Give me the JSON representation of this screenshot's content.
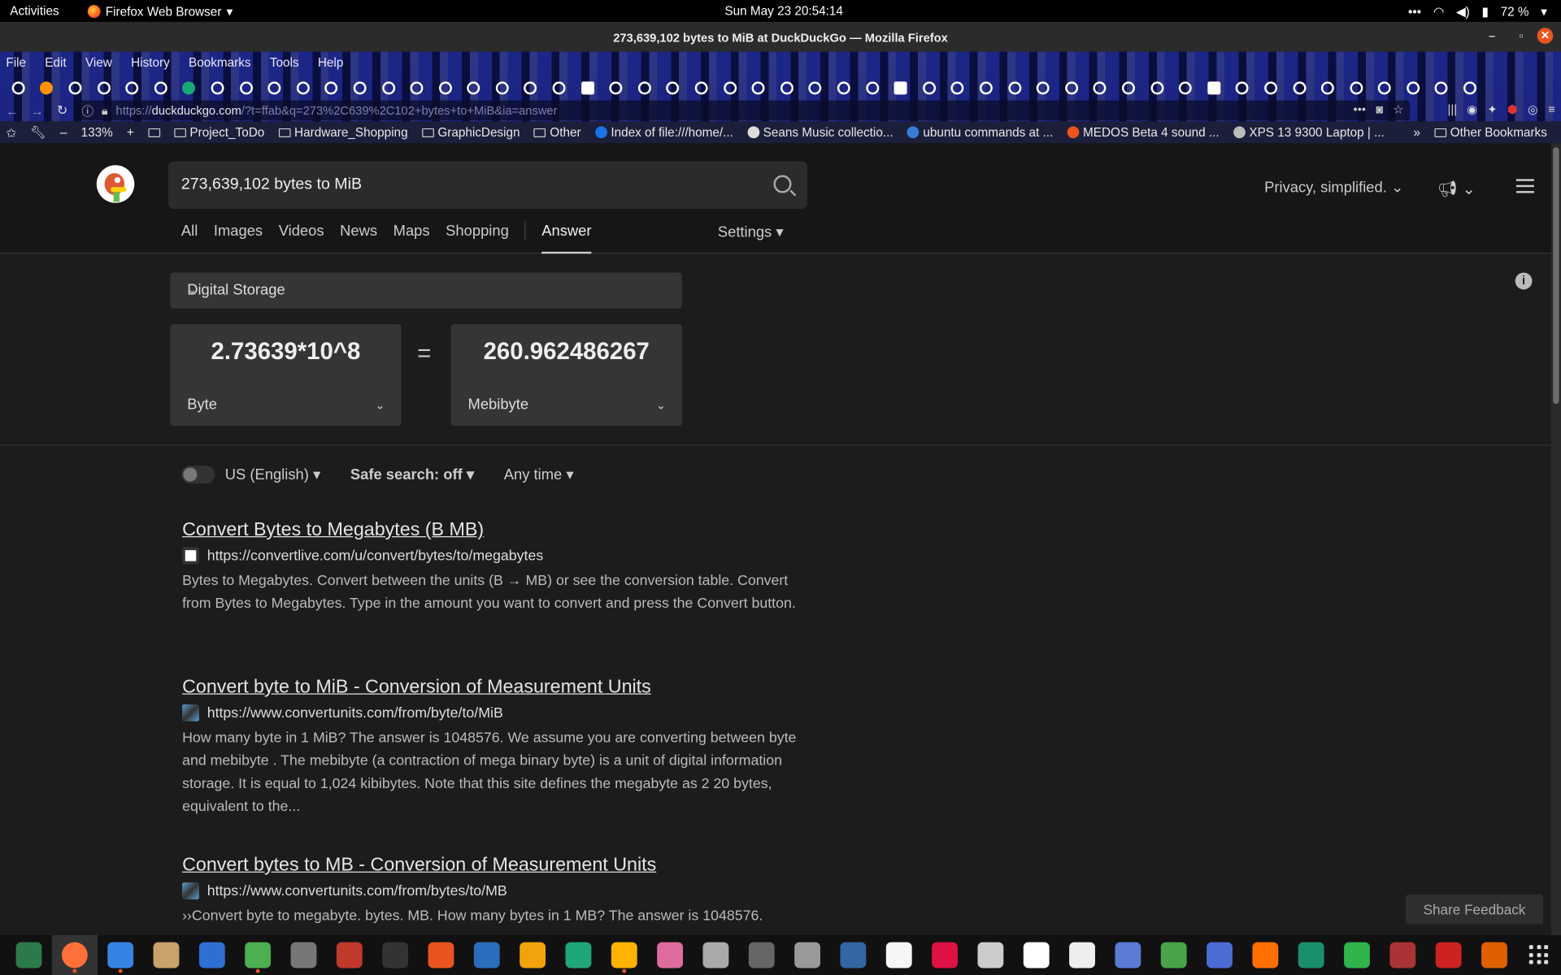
{
  "topbar": {
    "activities": "Activities",
    "app_name": "Firefox Web Browser",
    "clock": "Sun May 23  20:54:14",
    "battery": "72 %"
  },
  "window": {
    "title": "273,639,102 bytes to MiB at DuckDuckGo — Mozilla Firefox"
  },
  "menubar": [
    "File",
    "Edit",
    "View",
    "History",
    "Bookmarks",
    "Tools",
    "Help"
  ],
  "urlbar": {
    "host": "duckduckgo.com",
    "url_rest": "/?t=ffab&q=273%2C639%2C102+bytes+to+MiB&ia=answer",
    "zoom": "133%"
  },
  "bookmarks": [
    {
      "label": "Project_ToDo",
      "kind": "folder"
    },
    {
      "label": "Hardware_Shopping",
      "kind": "folder"
    },
    {
      "label": "GraphicDesign",
      "kind": "folder"
    },
    {
      "label": "Other",
      "kind": "folder"
    },
    {
      "label": "Index of file:///home/...",
      "kind": "page"
    },
    {
      "label": "Seans Music collectio...",
      "kind": "page"
    },
    {
      "label": "ubuntu commands at ...",
      "kind": "page"
    },
    {
      "label": "MEDOS Beta 4 sound ...",
      "kind": "page"
    },
    {
      "label": "XPS 13 9300 Laptop | ...",
      "kind": "page"
    }
  ],
  "other_bookmarks": "Other Bookmarks",
  "search": {
    "query": "273,639,102 bytes to MiB",
    "privacy": "Privacy, simplified.",
    "tabs": [
      "All",
      "Images",
      "Videos",
      "News",
      "Maps",
      "Shopping"
    ],
    "active_tab": "Answer",
    "settings": "Settings"
  },
  "converter": {
    "category": "Digital Storage",
    "from_value": "2.73639*10^8",
    "from_unit": "Byte",
    "equals": "=",
    "to_value": "260.962486267",
    "to_unit": "Mebibyte"
  },
  "filters": {
    "region": "US (English)",
    "safe_search": "Safe search: off",
    "time": "Any time"
  },
  "results": [
    {
      "title": "Convert Bytes to Megabytes (B MB)",
      "url": "https://convertlive.com/u/convert/bytes/to/megabytes",
      "snippet": "Bytes to Megabytes. Convert between the units (B → MB) or see the conversion table. Convert from Bytes to Megabytes. Type in the amount you want to convert and press the Convert button."
    },
    {
      "title": "Convert byte to MiB - Conversion of Measurement Units",
      "url": "https://www.convertunits.com/from/byte/to/MiB",
      "snippet": "How many byte in 1 MiB? The answer is 1048576. We assume you are converting between byte and mebibyte . The mebibyte (a contraction of mega binary byte) is a unit of digital information storage. It is equal to 1,024 kibibytes. Note that this site defines the megabyte as 2 20 bytes, equivalent to the..."
    },
    {
      "title": "Convert bytes to MB - Conversion of Measurement Units",
      "url": "https://www.convertunits.com/from/bytes/to/MB",
      "snippet": "››Convert byte to megabyte. bytes. MB. How many bytes in 1 MB? The answer is 1048576."
    }
  ],
  "feedback": "Share Feedback",
  "colors": {
    "page_bg": "#1c1c1c",
    "header_bg": "#161616",
    "accent": "#de5833",
    "ubuntu_orange": "#e95420"
  }
}
